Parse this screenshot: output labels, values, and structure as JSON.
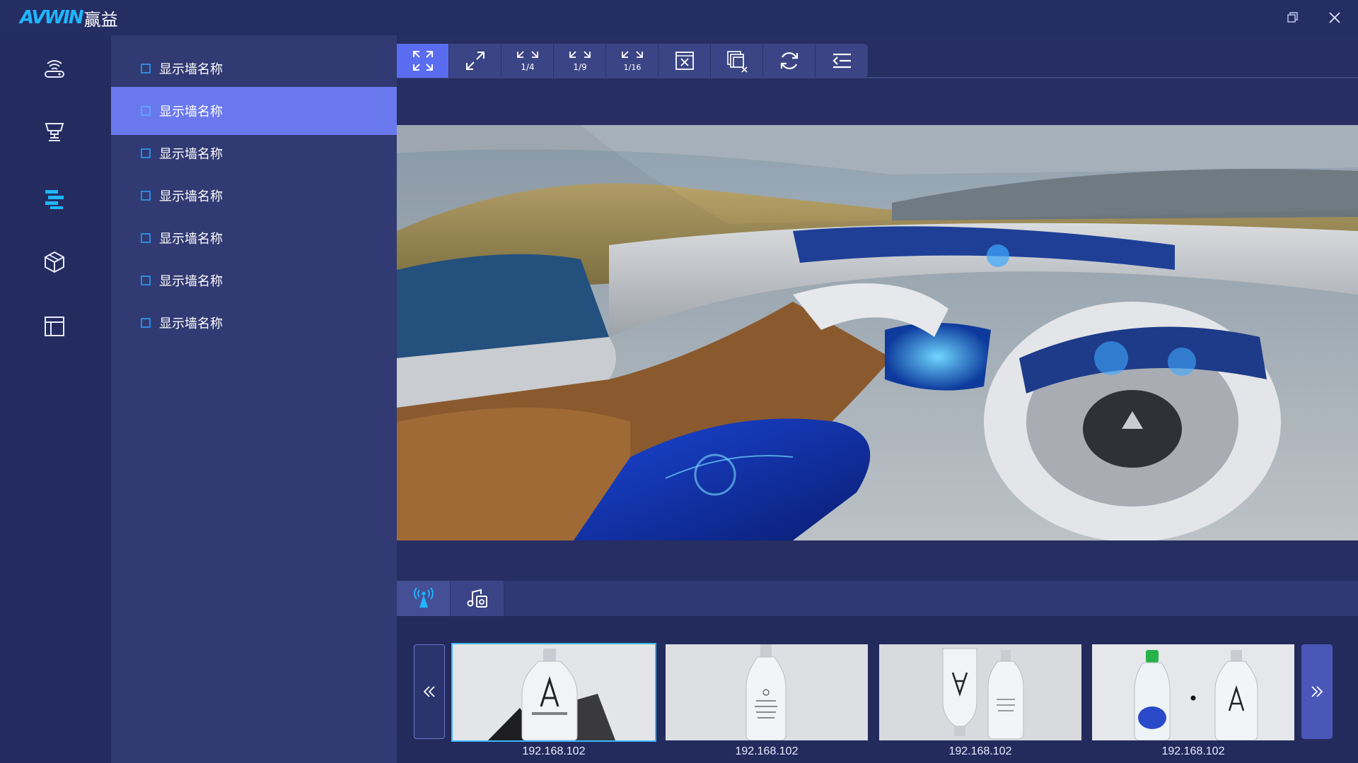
{
  "app": {
    "logo_en": "AVWIN",
    "logo_cn": "赢益"
  },
  "window_controls": {
    "restore": "restore-icon",
    "close": "close-icon"
  },
  "rail": {
    "items": [
      {
        "name": "signal-device-icon"
      },
      {
        "name": "trophy-icon"
      },
      {
        "name": "layers-icon",
        "active": true
      },
      {
        "name": "cube-icon"
      },
      {
        "name": "layout-icon"
      }
    ]
  },
  "walls": {
    "items": [
      {
        "label": "显示墙名称"
      },
      {
        "label": "显示墙名称",
        "active": true
      },
      {
        "label": "显示墙名称"
      },
      {
        "label": "显示墙名称"
      },
      {
        "label": "显示墙名称"
      },
      {
        "label": "显示墙名称"
      },
      {
        "label": "显示墙名称"
      }
    ]
  },
  "toolbar": {
    "buttons": [
      {
        "name": "fullscreen-icon",
        "active": true
      },
      {
        "name": "expand-icon"
      },
      {
        "name": "split-1-4-icon",
        "text": "1/4"
      },
      {
        "name": "split-1-9-icon",
        "text": "1/9"
      },
      {
        "name": "split-1-16-icon",
        "text": "1/16"
      },
      {
        "name": "close-window-icon"
      },
      {
        "name": "close-all-windows-icon"
      },
      {
        "name": "refresh-icon"
      },
      {
        "name": "menu-collapse-icon"
      }
    ]
  },
  "bottom_tabs": [
    {
      "name": "signal-source-icon",
      "active": true
    },
    {
      "name": "media-files-icon"
    }
  ],
  "thumbnails": [
    {
      "label": "192.168.102",
      "selected": true
    },
    {
      "label": "192.168.102"
    },
    {
      "label": "192.168.102"
    },
    {
      "label": "192.168.102"
    }
  ],
  "colors": {
    "accent": "#6a78ee",
    "brand": "#1fb6ff",
    "background": "#232b5c"
  }
}
